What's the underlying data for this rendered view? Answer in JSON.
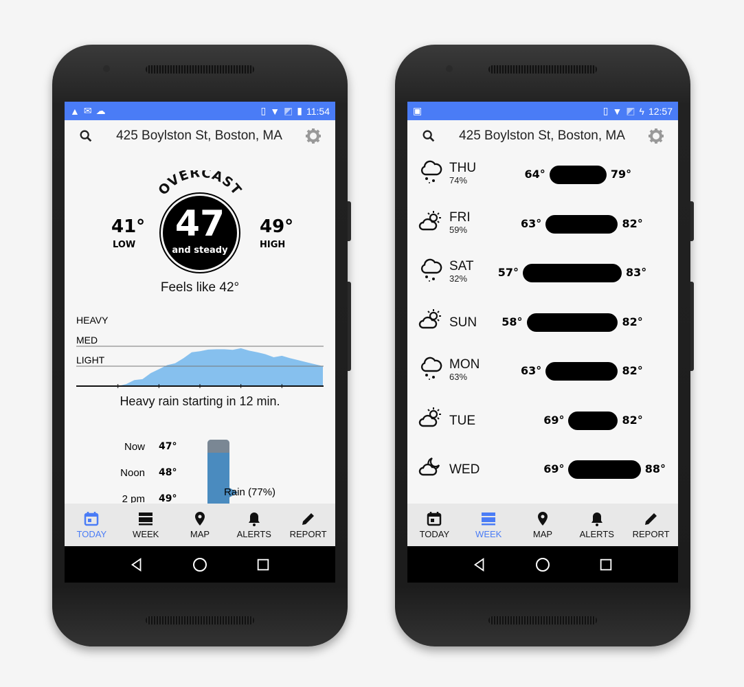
{
  "header": {
    "address": "425 Boylston St, Boston, MA"
  },
  "colors": {
    "accent": "#4a7cf6",
    "rain_fill": "#86c0ee",
    "rain_bar": "#4a8bbf",
    "rain_bar_top": "#7a8794"
  },
  "today": {
    "status_time": "11:54",
    "condition": "OVERCAST",
    "temp": "47",
    "temp_sub": "and steady",
    "low": "41°",
    "low_label": "LOW",
    "high": "49°",
    "high_label": "HIGH",
    "feels_like": "Feels like 42°",
    "rain_levels": [
      "HEAVY",
      "MED",
      "LIGHT"
    ],
    "summary": "Heavy rain starting in 12 min.",
    "hourly": [
      {
        "time": "Now",
        "temp": "47°"
      },
      {
        "time": "Noon",
        "temp": "48°"
      },
      {
        "time": "2 pm",
        "temp": "49°"
      }
    ],
    "rain_callout": "Rain (77%)"
  },
  "chart_data": {
    "type": "area",
    "xlabel": "",
    "ylabel": "",
    "x_ticks": [
      "10 min",
      "20 min",
      "30 min",
      "40 min",
      "50 min"
    ],
    "xlim": [
      0,
      60
    ],
    "y_levels": [
      "LIGHT",
      "MED",
      "HEAVY"
    ],
    "x": [
      10,
      12,
      14,
      16,
      18,
      20,
      22,
      24,
      26,
      28,
      30,
      32,
      34,
      36,
      38,
      40,
      42,
      44,
      46,
      48,
      50,
      52,
      54,
      56,
      58,
      60
    ],
    "y": [
      0,
      0.1,
      0.3,
      0.35,
      0.65,
      0.85,
      1.05,
      1.15,
      1.4,
      1.7,
      1.75,
      1.83,
      1.85,
      1.85,
      1.82,
      1.9,
      1.78,
      1.7,
      1.6,
      1.45,
      1.52,
      1.4,
      1.3,
      1.2,
      1.1,
      1.0
    ]
  },
  "week": {
    "status_time": "12:57",
    "days": [
      {
        "day": "THU",
        "pop": "74%",
        "icon": "rain",
        "lo": 64,
        "hi": 79
      },
      {
        "day": "FRI",
        "pop": "59%",
        "icon": "partly-cloudy",
        "lo": 63,
        "hi": 82
      },
      {
        "day": "SAT",
        "pop": "32%",
        "icon": "rain",
        "lo": 57,
        "hi": 83
      },
      {
        "day": "SUN",
        "pop": "",
        "icon": "partly-cloudy",
        "lo": 58,
        "hi": 82
      },
      {
        "day": "MON",
        "pop": "63%",
        "icon": "rain",
        "lo": 63,
        "hi": 82
      },
      {
        "day": "TUE",
        "pop": "",
        "icon": "partly-cloudy",
        "lo": 69,
        "hi": 82
      },
      {
        "day": "WED",
        "pop": "",
        "icon": "partly-cloudy-night",
        "lo": 69,
        "hi": 88
      }
    ]
  },
  "nav": {
    "items": [
      "TODAY",
      "WEEK",
      "MAP",
      "ALERTS",
      "REPORT"
    ]
  }
}
